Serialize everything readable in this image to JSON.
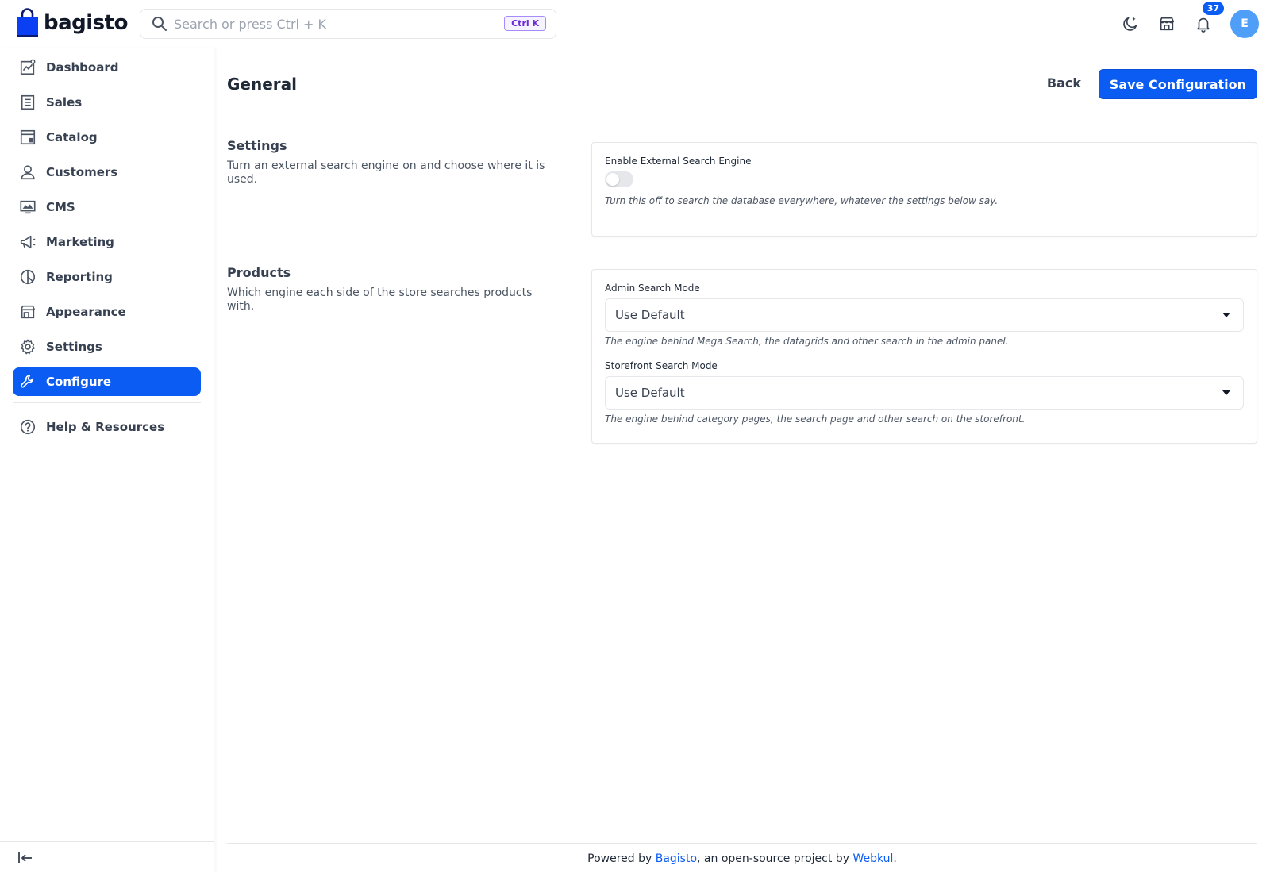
{
  "header": {
    "logo_text": "bagisto",
    "search_placeholder": "Search or press Ctrl + K",
    "search_shortcut": "Ctrl K",
    "notification_count": "37",
    "avatar_initial": "E"
  },
  "sidebar": {
    "items": [
      {
        "label": "Dashboard",
        "icon": "dashboard-icon"
      },
      {
        "label": "Sales",
        "icon": "sales-icon"
      },
      {
        "label": "Catalog",
        "icon": "catalog-icon"
      },
      {
        "label": "Customers",
        "icon": "customers-icon"
      },
      {
        "label": "CMS",
        "icon": "cms-icon"
      },
      {
        "label": "Marketing",
        "icon": "megaphone-icon"
      },
      {
        "label": "Reporting",
        "icon": "pie-chart-icon"
      },
      {
        "label": "Appearance",
        "icon": "store-icon"
      },
      {
        "label": "Settings",
        "icon": "gear-icon"
      },
      {
        "label": "Configure",
        "icon": "wrench-icon",
        "active": true
      }
    ],
    "help_label": "Help & Resources"
  },
  "page": {
    "title": "General",
    "back_label": "Back",
    "save_label": "Save Configuration"
  },
  "settings_section": {
    "title": "Settings",
    "description": "Turn an external search engine on and choose where it is used.",
    "toggle_label": "Enable External Search Engine",
    "toggle_value": false,
    "toggle_hint": "Turn this off to search the database everywhere, whatever the settings below say."
  },
  "products_section": {
    "title": "Products",
    "description": "Which engine each side of the store searches products with.",
    "admin_mode_label": "Admin Search Mode",
    "admin_mode_value": "Use Default",
    "admin_mode_hint": "The engine behind Mega Search, the datagrids and other search in the admin panel.",
    "storefront_mode_label": "Storefront Search Mode",
    "storefront_mode_value": "Use Default",
    "storefront_mode_hint": "The engine behind category pages, the search page and other search on the storefront."
  },
  "footer": {
    "prefix": "Powered by ",
    "link1": "Bagisto",
    "middle": ", an open-source project by ",
    "link2": "Webkul",
    "suffix": "."
  },
  "colors": {
    "primary": "#0b5cf3",
    "border": "#e5e7eb",
    "text": "#374151"
  }
}
